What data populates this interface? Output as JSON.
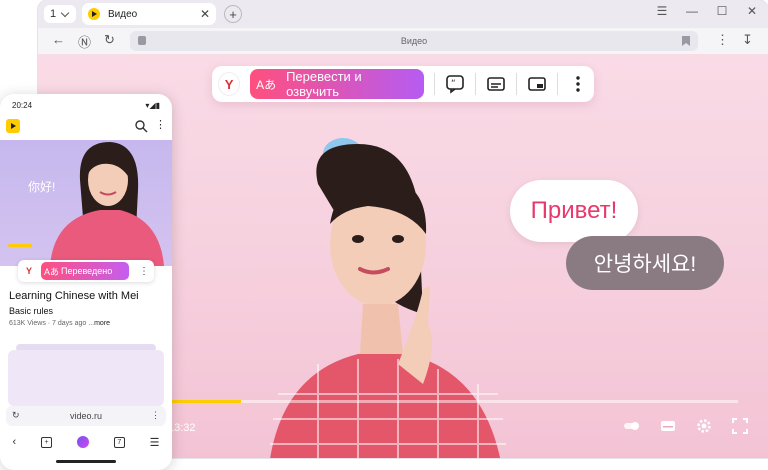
{
  "browser": {
    "tab_count": "1",
    "tab_title": "Видео",
    "tab_close": "✕",
    "new_tab": "+",
    "address": "Видео",
    "window_controls": [
      "☰",
      "—",
      "☐",
      "✕"
    ]
  },
  "overlay": {
    "logo": "Y",
    "translate_label": "Перевести и озвучить",
    "translate_icon": "Aあ"
  },
  "video": {
    "bubble_ru": "Привет!",
    "bubble_ko": "안녕하세요!",
    "time": "13:32",
    "progress": 0.29
  },
  "phone": {
    "status_time": "20:24",
    "status_icons": "▾◢▮",
    "nihao": "你好!",
    "overlay_logo": "Y",
    "overlay_icon": "Aあ",
    "overlay_label": "Переведено",
    "video_title": "Learning Chinese with Mei",
    "video_subtitle": "Basic rules",
    "video_meta": "613K Views · 7 days ago ...",
    "video_meta_more": "more",
    "address": "video.ru",
    "nav_tab_count": "7"
  },
  "colors": {
    "accent_gradient_start": "#ff4f7e",
    "accent_gradient_end": "#b65cf3",
    "progress": "#ffcc00",
    "video_bg": "#f6cfdd"
  }
}
